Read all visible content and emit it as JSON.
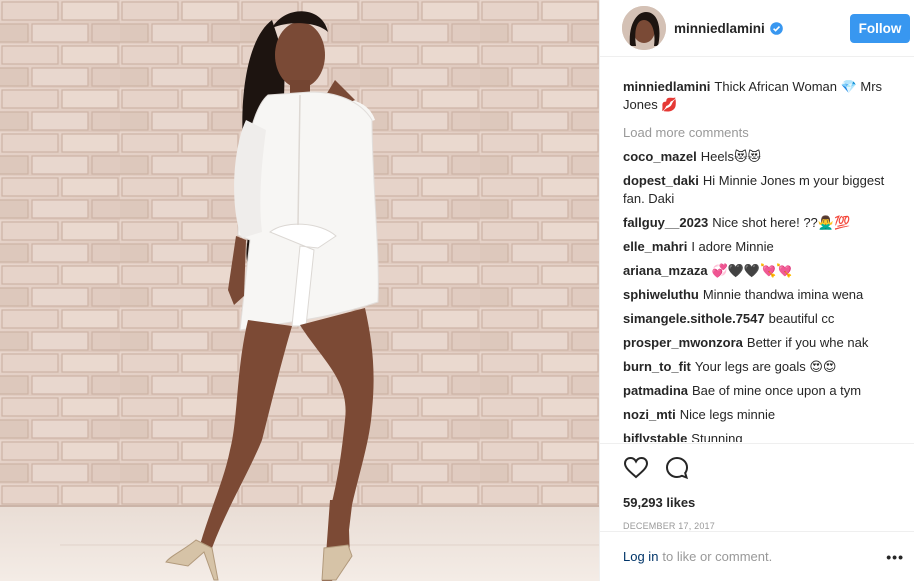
{
  "post": {
    "username": "minniedlamini",
    "follow_label": "Follow",
    "caption_user": "minniedlamini",
    "caption_text": "Thick African Woman 💎 Mrs Jones 💋",
    "load_more": "Load more comments",
    "comments": [
      {
        "user": "coco_mazel",
        "text": "Heels😻😻"
      },
      {
        "user": "dopest_daki",
        "text": "Hi Minnie Jones m your biggest fan. Daki"
      },
      {
        "user": "fallguy__2023",
        "text": "Nice shot here! ??🙅‍♂️💯"
      },
      {
        "user": "elle_mahri",
        "text": "I adore Minnie"
      },
      {
        "user": "ariana_mzaza",
        "text": "💞🖤🖤💘💘"
      },
      {
        "user": "sphiweluthu",
        "text": "Minnie thandwa imina wena"
      },
      {
        "user": "simangele.sithole.7547",
        "text": "beautiful cc"
      },
      {
        "user": "prosper_mwonzora",
        "text": "Better if you whe nak"
      },
      {
        "user": "burn_to_fit",
        "text": "Your legs are goals 😍😍"
      },
      {
        "user": "patmadina",
        "text": "Bae of mine once upon a tym"
      },
      {
        "user": "nozi_mti",
        "text": "Nice legs minnie"
      },
      {
        "user": "biflystable",
        "text": "Stunning"
      }
    ],
    "likes": "59,293 likes",
    "date": "DECEMBER 17, 2017",
    "login_link": "Log in",
    "login_text": "to like or comment.",
    "more_label": "•••"
  },
  "colors": {
    "accent": "#3897f0",
    "muted": "#999999",
    "text": "#262626",
    "link": "#003569"
  }
}
